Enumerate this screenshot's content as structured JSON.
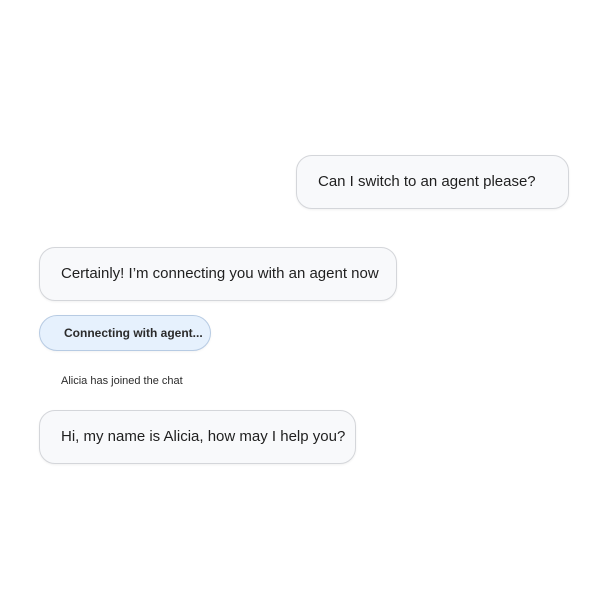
{
  "chat": {
    "messages": [
      {
        "role": "user",
        "text": "Can I switch to an agent please?"
      },
      {
        "role": "bot",
        "text": "Certainly! I’m connecting you with an agent now"
      },
      {
        "role": "status",
        "text": "Connecting with agent..."
      },
      {
        "role": "system",
        "text": "Alicia has joined the chat"
      },
      {
        "role": "agent",
        "text": "Hi, my name is Alicia, how may I help you?"
      }
    ]
  },
  "colors": {
    "bubble_bg": "#f8f9fb",
    "bubble_border": "#d4d6da",
    "status_bg": "#e6f1fd",
    "status_border": "#b7cbe3"
  }
}
